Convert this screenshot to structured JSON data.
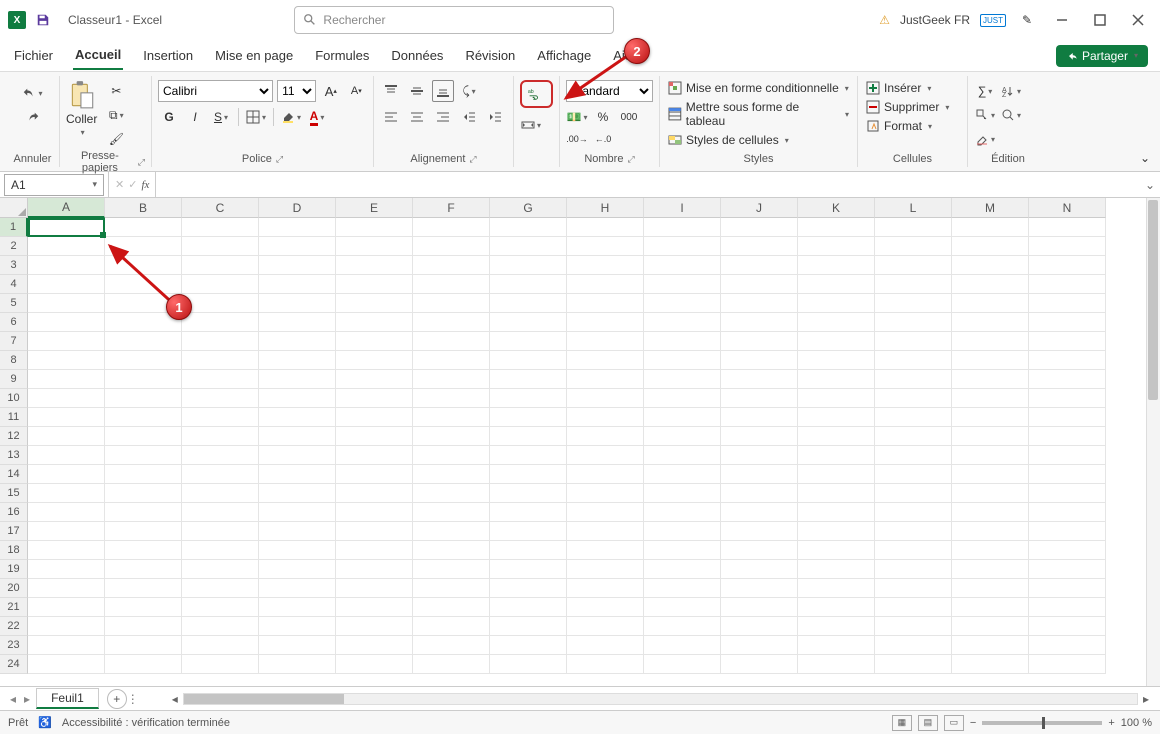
{
  "title": "Classeur1  -  Excel",
  "search_placeholder": "Rechercher",
  "user": "JustGeek FR",
  "user_badge": "JUST",
  "tabs": {
    "fichier": "Fichier",
    "accueil": "Accueil",
    "insertion": "Insertion",
    "mise": "Mise en page",
    "formules": "Formules",
    "donnees": "Données",
    "revision": "Révision",
    "affichage": "Affichage",
    "aide": "Aide"
  },
  "share": "Partager",
  "ribbon": {
    "annuler": "Annuler",
    "coller": "Coller",
    "presse": "Presse-papiers",
    "font_name": "Calibri",
    "font_size": "11",
    "police": "Police",
    "alignement": "Alignement",
    "number_format": "Standard",
    "nombre": "Nombre",
    "cond": "Mise en forme conditionnelle",
    "table": "Mettre sous forme de tableau",
    "cellstyles": "Styles de cellules",
    "styles": "Styles",
    "inserer": "Insérer",
    "supprimer": "Supprimer",
    "format": "Format",
    "cellules": "Cellules",
    "edition": "Édition"
  },
  "namebox": "A1",
  "columns": [
    "A",
    "B",
    "C",
    "D",
    "E",
    "F",
    "G",
    "H",
    "I",
    "J",
    "K",
    "L",
    "M",
    "N"
  ],
  "rows": [
    "1",
    "2",
    "3",
    "4",
    "5",
    "6",
    "7",
    "8",
    "9",
    "10",
    "11",
    "12",
    "13",
    "14",
    "15",
    "16",
    "17",
    "18",
    "19",
    "20",
    "21",
    "22",
    "23",
    "24"
  ],
  "sheet": "Feuil1",
  "status_ready": "Prêt",
  "status_access": "Accessibilité : vérification terminée",
  "zoom": "100 %",
  "callouts": {
    "c1": "1",
    "c2": "2"
  }
}
